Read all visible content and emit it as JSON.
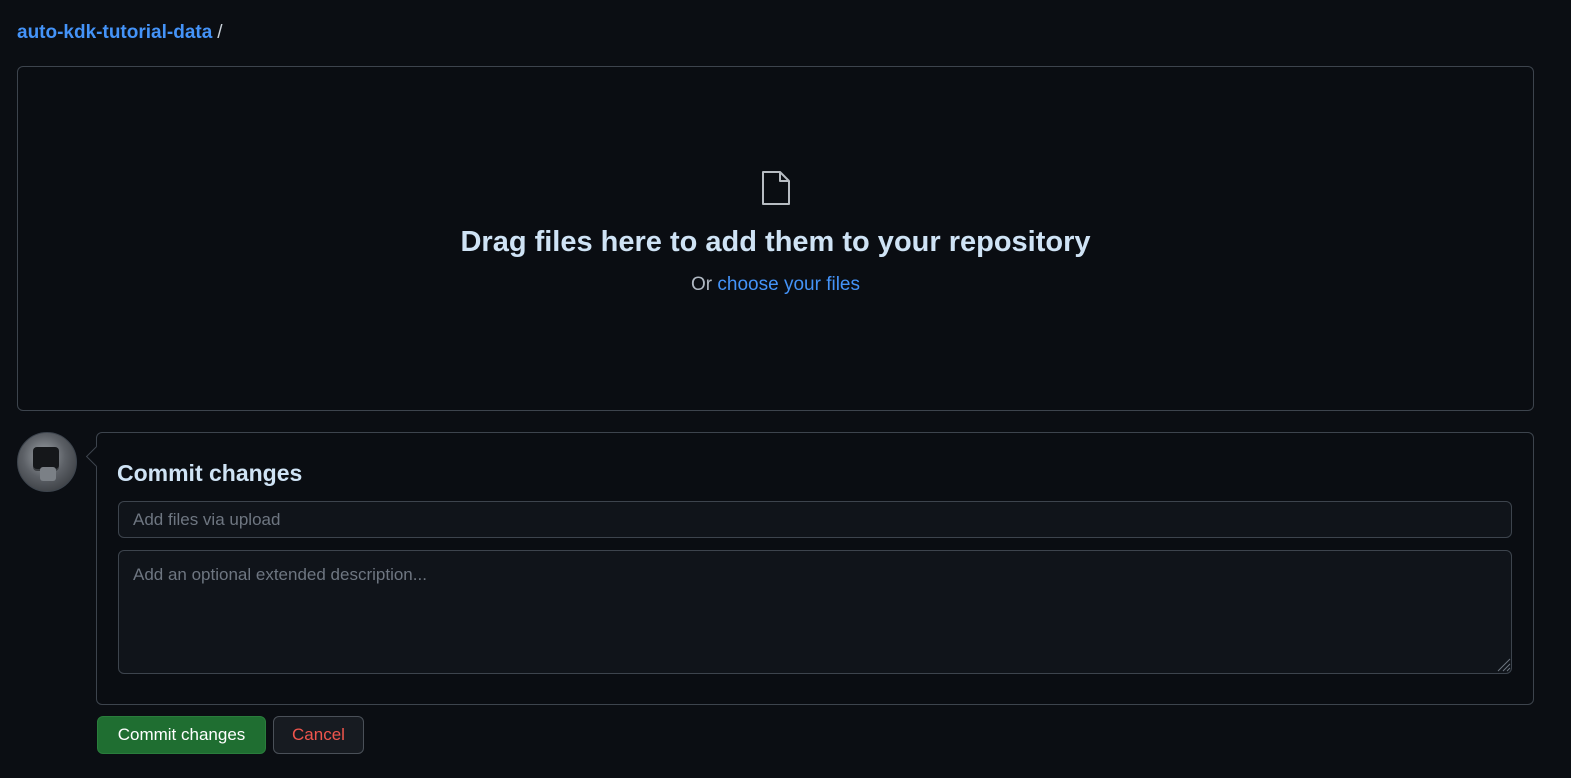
{
  "breadcrumb": {
    "repo_name": "auto-kdk-tutorial-data",
    "separator": "/"
  },
  "dropzone": {
    "icon": "file-icon",
    "headline": "Drag files here to add them to your repository",
    "prefix": "Or",
    "choose_link": "choose your files"
  },
  "commit": {
    "title": "Commit changes",
    "summary_placeholder": "Add files via upload",
    "summary_value": "",
    "description_placeholder": "Add an optional extended description...",
    "description_value": ""
  },
  "buttons": {
    "commit_label": "Commit changes",
    "cancel_label": "Cancel"
  },
  "colors": {
    "background": "#0b0e13",
    "link": "#4493f8",
    "commit_button": "#1f6e31",
    "cancel_text": "#f0554d",
    "border": "#3d444d"
  }
}
